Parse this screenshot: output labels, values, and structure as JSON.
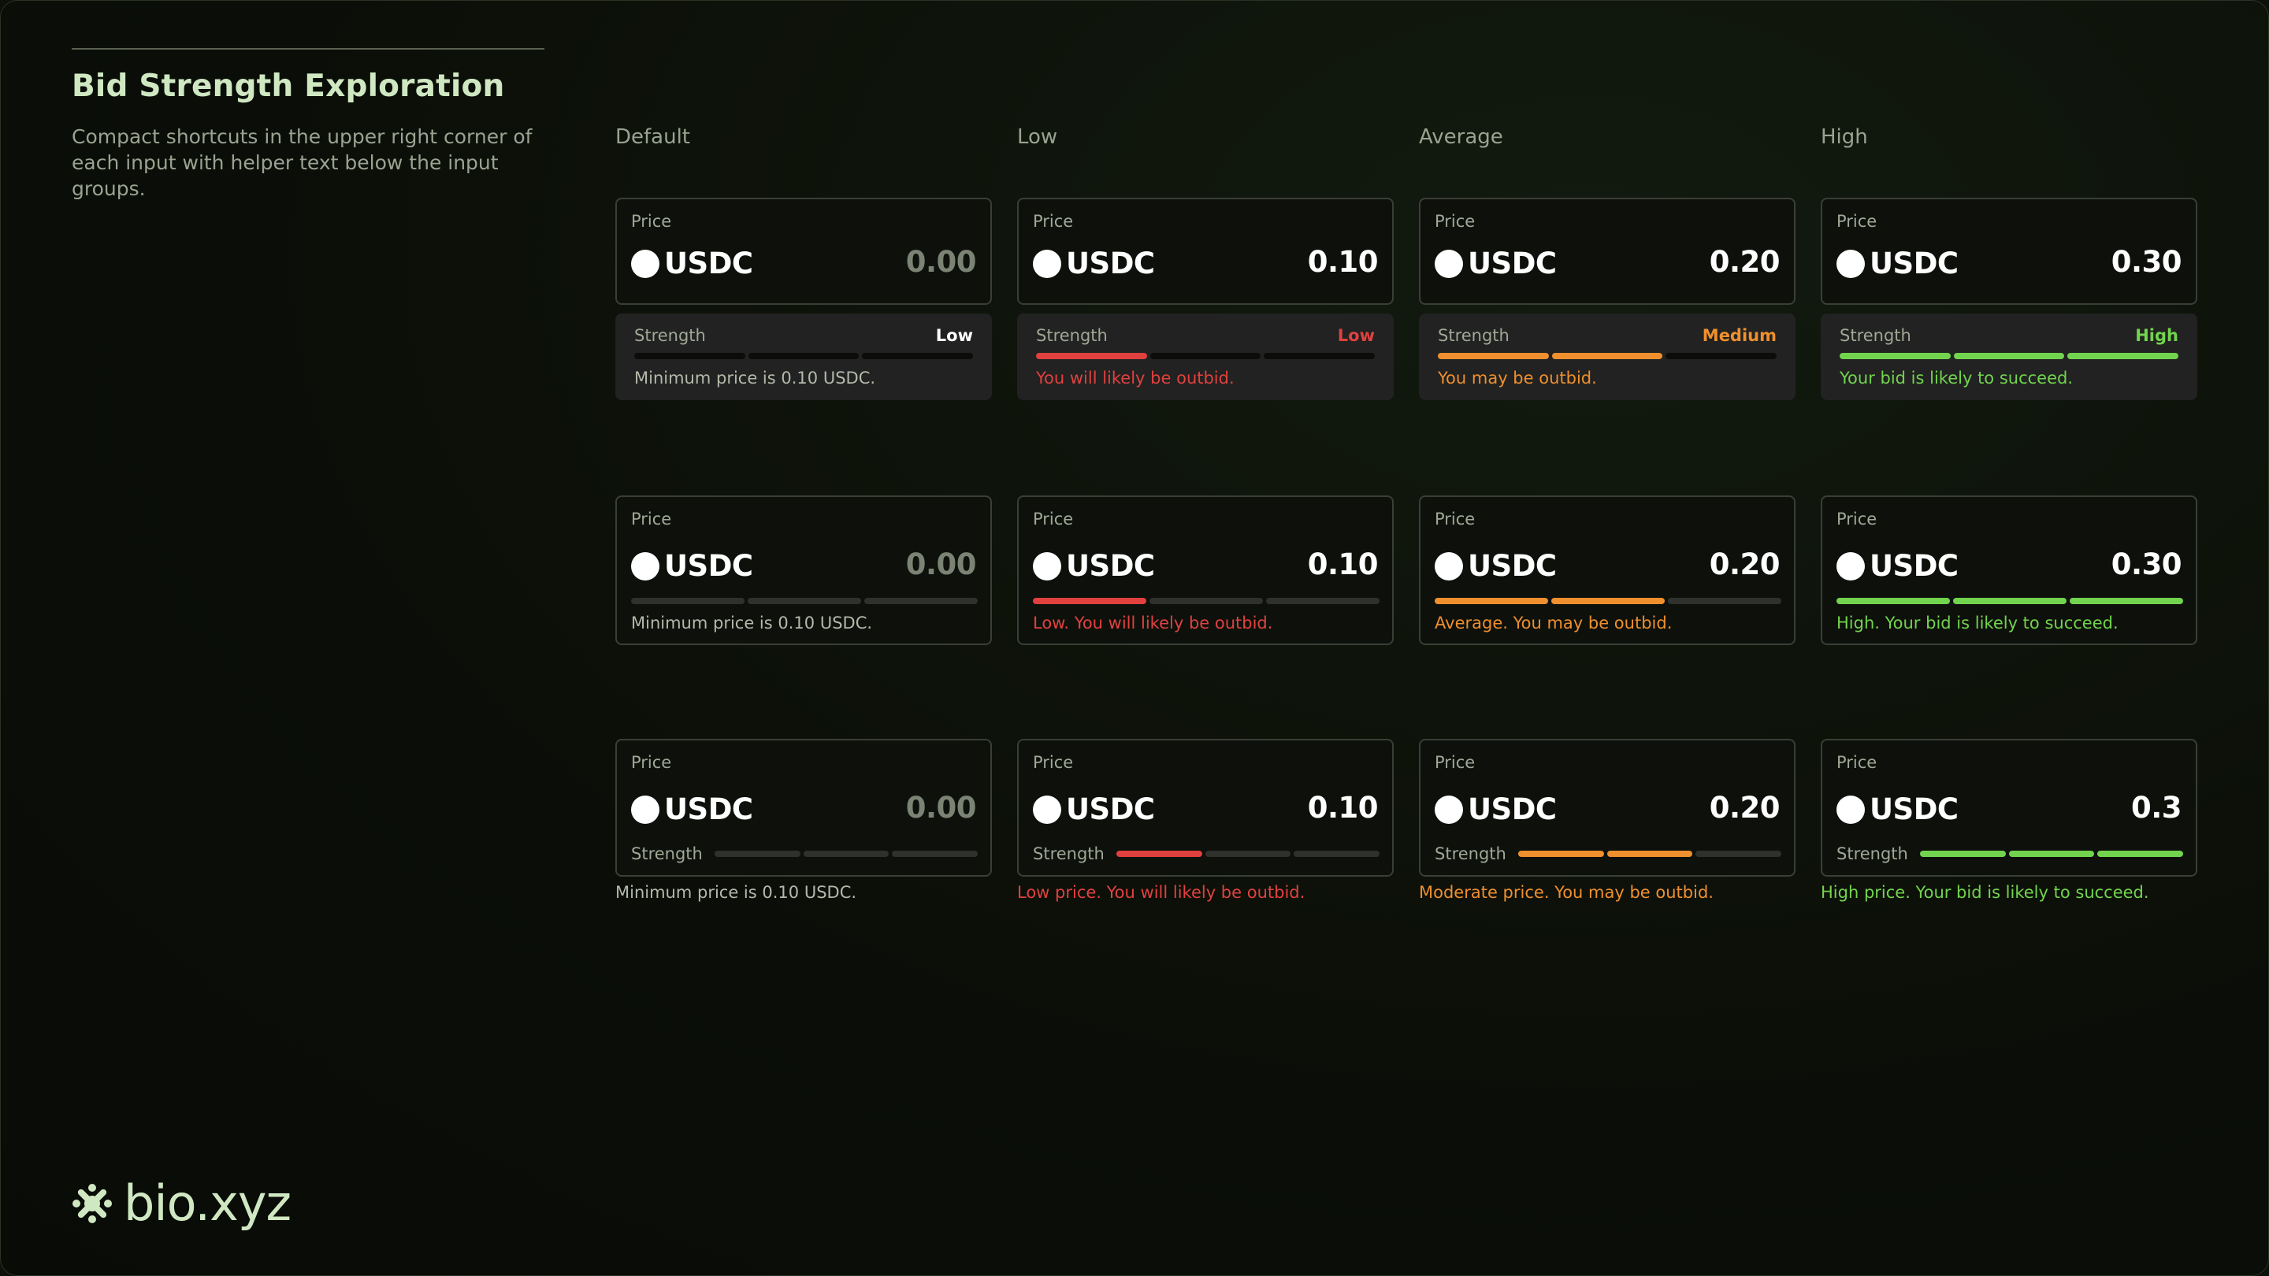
{
  "header": {
    "title": "Bid Strength Exploration",
    "description": "Compact shortcuts in the upper right corner of each input with helper text below the input groups."
  },
  "columns": [
    "Default",
    "Low",
    "Average",
    "High"
  ],
  "colors": {
    "neutral": "#b3b9aa",
    "low": "#e0413f",
    "medium": "#ef8f2e",
    "high": "#72d44e",
    "empty_bar": "#2e312c"
  },
  "price_label": "Price",
  "currency": "USDC",
  "strength_label": "Strength",
  "row1": [
    {
      "value": "0.00",
      "level": "Low",
      "filled": 0,
      "tone": "neutral",
      "helper": "Minimum price is 0.10 USDC.",
      "level_tone": "white"
    },
    {
      "value": "0.10",
      "level": "Low",
      "filled": 1,
      "tone": "low",
      "helper": "You will likely be outbid.",
      "level_tone": "low"
    },
    {
      "value": "0.20",
      "level": "Medium",
      "filled": 2,
      "tone": "medium",
      "helper": "You may be outbid.",
      "level_tone": "medium"
    },
    {
      "value": "0.30",
      "level": "High",
      "filled": 3,
      "tone": "high",
      "helper": "Your bid is likely to succeed.",
      "level_tone": "high"
    }
  ],
  "row2": [
    {
      "value": "0.00",
      "filled": 0,
      "tone": "neutral",
      "helper": "Minimum price is 0.10 USDC."
    },
    {
      "value": "0.10",
      "filled": 1,
      "tone": "low",
      "helper": "Low. You will likely be outbid."
    },
    {
      "value": "0.20",
      "filled": 2,
      "tone": "medium",
      "helper": "Average. You may be outbid."
    },
    {
      "value": "0.30",
      "filled": 3,
      "tone": "high",
      "helper": "High. Your bid is likely to succeed."
    }
  ],
  "row3": [
    {
      "value": "0.00",
      "filled": 0,
      "tone": "neutral",
      "helper": "Minimum price is 0.10 USDC."
    },
    {
      "value": "0.10",
      "filled": 1,
      "tone": "low",
      "helper": "Low price. You will likely be outbid."
    },
    {
      "value": "0.20",
      "filled": 2,
      "tone": "medium",
      "helper": "Moderate price. You may be outbid."
    },
    {
      "value": "0.3",
      "filled": 3,
      "tone": "high",
      "helper": "High price. Your bid is likely to succeed."
    }
  ],
  "logo": {
    "text": "bio.xyz",
    "icon": "bio-asterisk-logo-icon"
  }
}
